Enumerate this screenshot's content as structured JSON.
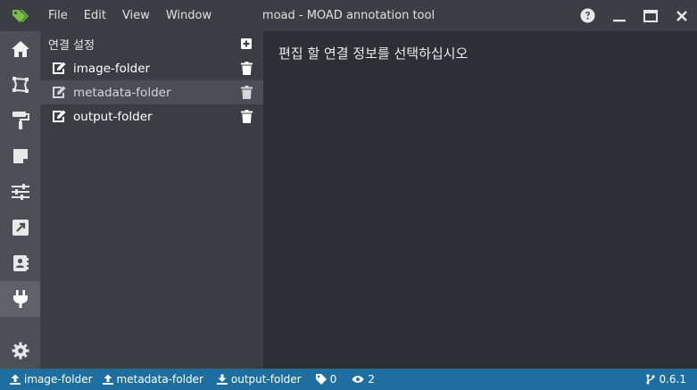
{
  "window": {
    "title": "moad - MOAD annotation tool",
    "menu": [
      "File",
      "Edit",
      "View",
      "Window"
    ]
  },
  "rail": {
    "items": [
      "home-icon",
      "shape-icon",
      "paint-roller-icon",
      "note-icon",
      "sliders-icon",
      "external-link-icon",
      "contact-book-icon",
      "plug-icon"
    ],
    "active": "plug-icon",
    "bottom": "gear-icon"
  },
  "panel": {
    "title": "연결 설정",
    "items": [
      {
        "label": "image-folder"
      },
      {
        "label": "metadata-folder"
      },
      {
        "label": "output-folder"
      }
    ],
    "selected_index": 1
  },
  "main": {
    "message": "편집 할 연결 정보를 선택하십시오"
  },
  "status": {
    "image_folder": "image-folder",
    "metadata_folder": "metadata-folder",
    "output_folder": "output-folder",
    "tag_count": "0",
    "view_count": "2",
    "version": "0.6.1"
  },
  "colors": {
    "accent_green": "#7ac143",
    "statusbar": "#1e6fa0"
  }
}
